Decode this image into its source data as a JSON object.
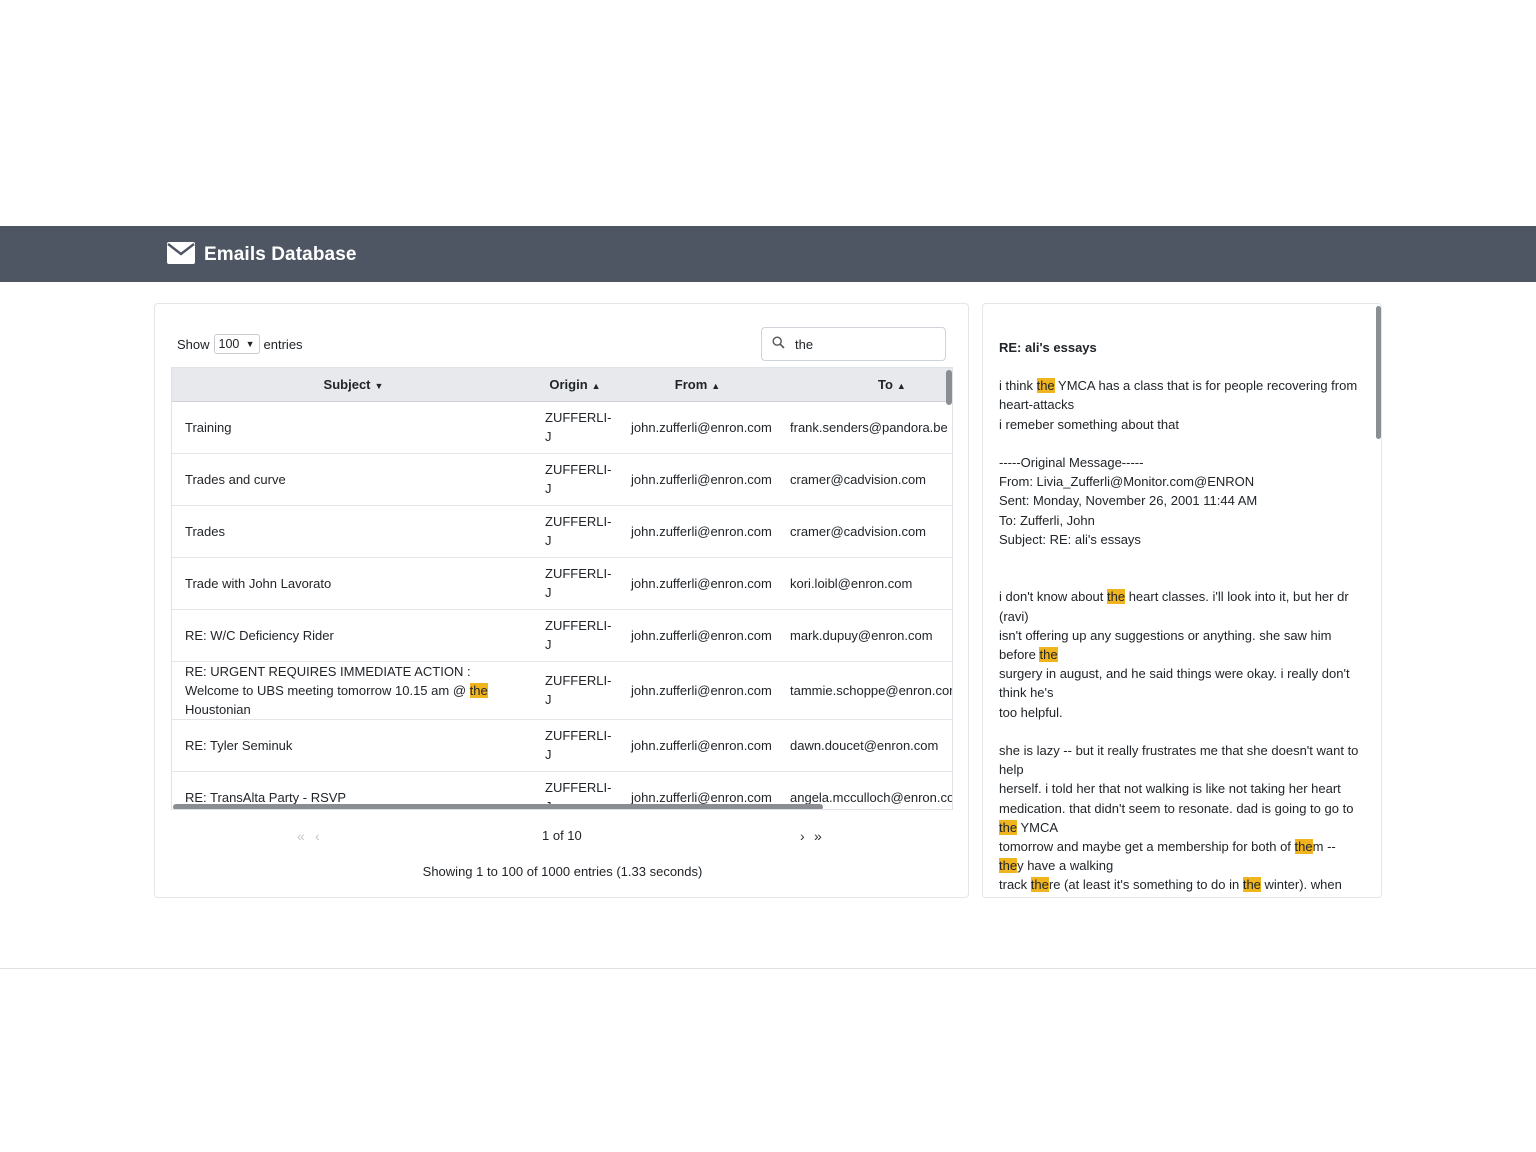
{
  "app": {
    "title": "Emails Database",
    "logo_icon": "envelope-icon"
  },
  "controls": {
    "show_label": "Show",
    "entries_label": "entries",
    "page_size": "100",
    "search_value": "the"
  },
  "table": {
    "columns": [
      "Subject",
      "Origin",
      "From",
      "To"
    ],
    "rows": [
      {
        "subject_pre": "Training",
        "subject_hl": "",
        "subject_post": "",
        "origin": "ZUFFERLI-J",
        "from": "john.zufferli@enron.com",
        "to": "frank.senders@pandora.be"
      },
      {
        "subject_pre": "Trades and curve",
        "subject_hl": "",
        "subject_post": "",
        "origin": "ZUFFERLI-J",
        "from": "john.zufferli@enron.com",
        "to": "cramer@cadvision.com"
      },
      {
        "subject_pre": "Trades",
        "subject_hl": "",
        "subject_post": "",
        "origin": "ZUFFERLI-J",
        "from": "john.zufferli@enron.com",
        "to": "cramer@cadvision.com"
      },
      {
        "subject_pre": "Trade with John Lavorato",
        "subject_hl": "",
        "subject_post": "",
        "origin": "ZUFFERLI-J",
        "from": "john.zufferli@enron.com",
        "to": "kori.loibl@enron.com"
      },
      {
        "subject_pre": "RE: W/C Deficiency Rider",
        "subject_hl": "",
        "subject_post": "",
        "origin": "ZUFFERLI-J",
        "from": "john.zufferli@enron.com",
        "to": "mark.dupuy@enron.com"
      },
      {
        "subject_pre": "RE: URGENT REQUIRES IMMEDIATE ACTION : Welcome to UBS meeting tomorrow 10.15 am @ ",
        "subject_hl": "the",
        "subject_post": " Houstonian",
        "origin": "ZUFFERLI-J",
        "from": "john.zufferli@enron.com",
        "to": "tammie.schoppe@enron.com"
      },
      {
        "subject_pre": "RE: Tyler Seminuk",
        "subject_hl": "",
        "subject_post": "",
        "origin": "ZUFFERLI-J",
        "from": "john.zufferli@enron.com",
        "to": "dawn.doucet@enron.com"
      },
      {
        "subject_pre": "RE: TransAlta Party - RSVP",
        "subject_hl": "",
        "subject_post": "",
        "origin": "ZUFFERLI-J",
        "from": "john.zufferli@enron.com",
        "to": "angela.mcculloch@enron.com"
      }
    ]
  },
  "pagination": {
    "info": "1 of 10",
    "summary": "Showing 1 to 100 of 1000 entries (1.33 seconds)"
  },
  "message": {
    "subject": "RE: ali's essays",
    "lines": [
      [
        {
          "t": "i think "
        },
        {
          "t": "the",
          "hl": true
        },
        {
          "t": " YMCA has a class that is for people recovering from"
        }
      ],
      [
        {
          "t": "heart-attacks"
        }
      ],
      [
        {
          "t": "i remeber something about that"
        }
      ],
      [
        {
          "t": ""
        }
      ],
      [
        {
          "t": "-----Original Message-----"
        }
      ],
      [
        {
          "t": "From: Livia_Zufferli@Monitor.com@ENRON"
        }
      ],
      [
        {
          "t": "Sent: Monday, November 26, 2001 11:44 AM"
        }
      ],
      [
        {
          "t": "To: Zufferli, John"
        }
      ],
      [
        {
          "t": "Subject: RE: ali's essays"
        }
      ],
      [
        {
          "t": ""
        }
      ],
      [
        {
          "t": ""
        }
      ],
      [
        {
          "t": "i don't know about "
        },
        {
          "t": "the",
          "hl": true
        },
        {
          "t": " heart classes. i'll look into it, but her dr"
        }
      ],
      [
        {
          "t": "(ravi)"
        }
      ],
      [
        {
          "t": "isn't offering up any suggestions or anything. she saw him"
        }
      ],
      [
        {
          "t": "before "
        },
        {
          "t": "the",
          "hl": true
        }
      ],
      [
        {
          "t": "surgery in august, and he said things were okay. i really don't"
        }
      ],
      [
        {
          "t": "think he's"
        }
      ],
      [
        {
          "t": "too helpful."
        }
      ],
      [
        {
          "t": ""
        }
      ],
      [
        {
          "t": "she is lazy -- but it really frustrates me that she doesn't want to"
        }
      ],
      [
        {
          "t": "help"
        }
      ],
      [
        {
          "t": "herself. i told her that not walking is like not taking her heart"
        }
      ],
      [
        {
          "t": "medication. that didn't seem to resonate. dad is going to go to"
        }
      ],
      [
        {
          "t": "the",
          "hl": true
        },
        {
          "t": " YMCA"
        }
      ],
      [
        {
          "t": "tomorrow and maybe get a membership for both of "
        },
        {
          "t": "the",
          "hl": true
        },
        {
          "t": "m --"
        }
      ],
      [
        {
          "t": "the",
          "hl": true
        },
        {
          "t": "y have a walking"
        }
      ],
      [
        {
          "t": "track "
        },
        {
          "t": "the",
          "hl": true
        },
        {
          "t": "re (at least it's something to do in "
        },
        {
          "t": "the",
          "hl": true
        },
        {
          "t": " winter). when"
        }
      ]
    ]
  },
  "colors": {
    "navbar": "#4f5663",
    "highlight": "#f0b51e"
  }
}
